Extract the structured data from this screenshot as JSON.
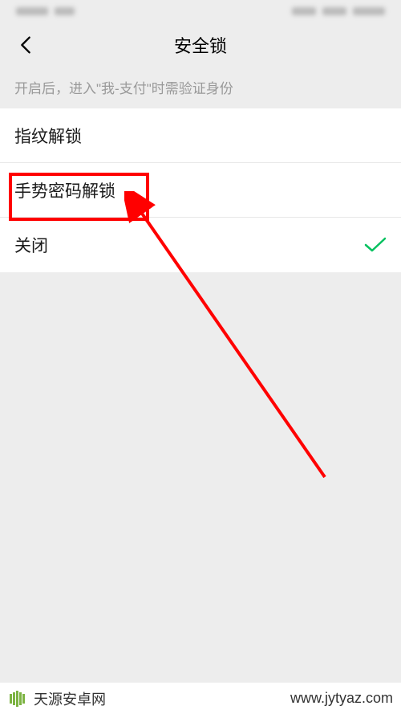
{
  "nav": {
    "title": "安全锁"
  },
  "description": "开启后，进入\"我-支付\"时需验证身份",
  "options": {
    "fingerprint": {
      "label": "指纹解锁"
    },
    "gesture": {
      "label": "手势密码解锁"
    },
    "close": {
      "label": "关闭"
    }
  },
  "watermark": {
    "site_name": "天源安卓网",
    "url": "www.jytyaz.com"
  }
}
